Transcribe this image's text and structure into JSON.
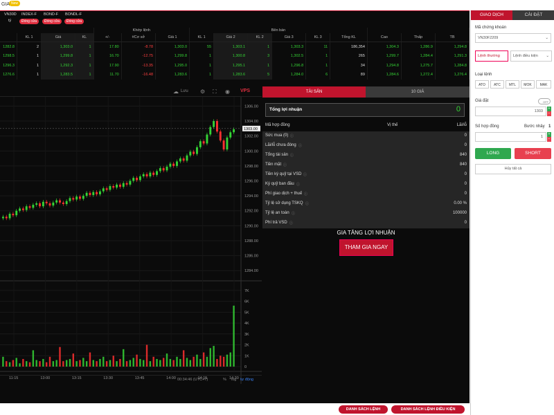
{
  "topbar": {
    "title": "GIA",
    "badge": "New"
  },
  "tickers": [
    {
      "name": "VN30D",
      "sub": "tỷ",
      "status": "Đóng cửa"
    },
    {
      "name": "INDEX-F",
      "sub": "",
      "status": "Đóng cửa"
    },
    {
      "name": "BOND-F",
      "sub": "",
      "status": "Đóng cửa"
    },
    {
      "name": "BONDL-F",
      "sub": "",
      "status": "Đóng cửa"
    }
  ],
  "board": {
    "group_headers": {
      "matched": "Khớp lệnh",
      "sell": "Bên bán"
    },
    "columns": [
      "KL 1",
      "Giá",
      "KL",
      "+/-",
      "#Cơ sở",
      "Giá 1",
      "KL 1",
      "Giá 2",
      "KL 2",
      "Giá 3",
      "KL 3",
      "Tổng KL",
      "Cao",
      "Thấp",
      "TB"
    ],
    "rows": [
      {
        "c0": "1282.8",
        "c1": "2",
        "c2": "1,303.0",
        "c3": "1",
        "c4": "17.80",
        "c5": "-8.78",
        "c6": "1,303.0",
        "c7": "55",
        "c8": "1,303.1",
        "c9": "1",
        "c10": "1,303.3",
        "c11": "11",
        "c12": "186,354",
        "c13": "1,304.3",
        "c14": "1,286.9",
        "c15": "1,294.8"
      },
      {
        "c0": "1298.5",
        "c1": "1",
        "c2": "1,299.8",
        "c3": "1",
        "c4": "16.70",
        "c5": "-12.75",
        "c6": "1,299.8",
        "c7": "1",
        "c8": "1,300.8",
        "c9": "3",
        "c10": "1,302.5",
        "c11": "1",
        "c12": "265",
        "c13": "1,299.7",
        "c14": "1,284.4",
        "c15": "1,291.3"
      },
      {
        "c0": "1296.3",
        "c1": "1",
        "c2": "1,292.3",
        "c3": "1",
        "c4": "17.90",
        "c5": "-13.35",
        "c6": "1,295.0",
        "c7": "1",
        "c8": "1,295.1",
        "c9": "1",
        "c10": "1,296.8",
        "c11": "1",
        "c12": "34",
        "c13": "1,294.8",
        "c14": "1,275.7",
        "c15": "1,284.8"
      },
      {
        "c0": "1276.6",
        "c1": "1",
        "c2": "1,283.5",
        "c3": "1",
        "c4": "11.70",
        "c5": "-16.48",
        "c6": "1,283.6",
        "c7": "1",
        "c8": "1,283.6",
        "c9": "5",
        "c10": "1,284.0",
        "c11": "6",
        "c12": "89",
        "c13": "1,284.6",
        "c14": "1,272.4",
        "c15": "1,276.4"
      }
    ]
  },
  "chart_toolbar": {
    "save": "Lưu",
    "logo": "VPS"
  },
  "chart_data": {
    "type": "candlestick",
    "x_ticks": [
      "11:15",
      "13:00",
      "13:15",
      "13:30",
      "13:45",
      "14:00",
      "14:15",
      "14:30"
    ],
    "price_ticks": [
      "1306.00",
      "1304.00",
      "1302.00",
      "1300.00",
      "1298.00",
      "1296.00",
      "1294.00",
      "1292.00",
      "1290.00",
      "1288.00",
      "1286.00",
      "1284.00"
    ],
    "volume_ticks": [
      "7K",
      "6K",
      "5K",
      "4K",
      "3K",
      "2K",
      "1K",
      "0"
    ],
    "price_range": [
      1283,
      1306.5
    ],
    "volume_range": [
      0,
      7500
    ],
    "current_price": "1303.00",
    "closes": [
      1291.2,
      1291.0,
      1291.6,
      1291.4,
      1292.0,
      1292.3,
      1292.1,
      1292.6,
      1292.4,
      1292.8,
      1293.0,
      1292.6,
      1293.2,
      1293.0,
      1292.7,
      1293.1,
      1293.4,
      1293.1,
      1292.9,
      1293.3,
      1293.7,
      1293.5,
      1293.9,
      1293.6,
      1294.0,
      1294.4,
      1294.1,
      1294.5,
      1294.2,
      1294.6,
      1295.0,
      1294.8,
      1295.3,
      1295.1,
      1295.5,
      1295.2,
      1295.7,
      1295.5,
      1296.0,
      1296.4,
      1296.1,
      1296.6,
      1296.9,
      1296.6,
      1297.1,
      1296.8,
      1297.3,
      1297.7,
      1297.4,
      1297.9,
      1298.3,
      1298.0,
      1298.6,
      1299.0,
      1298.7,
      1299.4,
      1299.9,
      1299.6,
      1300.5,
      1301.3,
      1301.0,
      1302.2,
      1303.2,
      1304.0,
      1302.6,
      1301.4,
      1300.2,
      1301.8,
      1302.5,
      1302.9
    ],
    "volumes": [
      900,
      500,
      400,
      600,
      800,
      300,
      700,
      500,
      400,
      1500,
      600,
      500,
      700,
      400,
      900,
      500,
      600,
      1800,
      500,
      600,
      700,
      1200,
      500,
      600,
      800,
      500,
      1300,
      600,
      500,
      700,
      900,
      500,
      600,
      1000,
      500,
      700,
      1600,
      500,
      600,
      800,
      1100,
      700,
      600,
      2000,
      500,
      900,
      700,
      600,
      800,
      1200,
      700,
      600,
      900,
      700,
      1500,
      800,
      600,
      900,
      1100,
      700,
      1300,
      900,
      1700,
      1900,
      700,
      1000,
      900,
      1100,
      1300,
      5600
    ],
    "time_label": "00:34:46 (UTC+7)",
    "footer_pct": "%",
    "footer_log": "log",
    "footer_auto": "tự động"
  },
  "trade_tabs": {
    "asset": "TÀI SẢN",
    "ten_price": "10 GIÁ"
  },
  "profit": {
    "label": "Tổng lợi nhuận",
    "value": "0"
  },
  "positions_header": {
    "contract": "Mã hợp đồng",
    "position": "Vị thế",
    "pl": "Lãi/lỗ"
  },
  "account_rows": [
    {
      "label": "Sức mua (0)",
      "value": "0"
    },
    {
      "label": "Lãi/lỗ chưa đóng",
      "value": "0"
    },
    {
      "label": "Tổng tài sản",
      "value": "840"
    },
    {
      "label": "Tiền mặt",
      "value": "840"
    },
    {
      "label": "Tiền ký quỹ tại VSD",
      "value": "0"
    },
    {
      "label": "Ký quỹ ban đầu",
      "value": "0"
    },
    {
      "label": "Phí giao dịch + thuế",
      "value": "0"
    },
    {
      "label": "Tỷ lệ sử dụng TSKQ",
      "value": "0.00 %"
    },
    {
      "label": "Tỷ lệ an toàn",
      "value": "100000"
    },
    {
      "label": "Phí trả VSD",
      "value": "0"
    }
  ],
  "promo": {
    "title": "GIA TĂNG LỢI NHUẬN",
    "button": "THAM GIA NGAY"
  },
  "order_panel": {
    "tab_trade": "GIAO DỊCH",
    "tab_settings": "CÀI ĐẶT",
    "symbol_label": "Mã chứng khoán",
    "symbol_value": "VN30F2209",
    "mode_normal": "Lệnh thường",
    "mode_conditional": "Lệnh điều kiện",
    "order_type_label": "Loại lệnh",
    "order_types": [
      "ATO",
      "ATC",
      "MTL",
      "MOK",
      "MAK"
    ],
    "price_label": "Giá đặt",
    "toggle_label": "OFF",
    "price_value": "1303",
    "qty_label": "Số hợp đồng",
    "step_label": "Bước nhảy",
    "step_value": "1",
    "qty_value": "1",
    "long_label": "LONG",
    "short_label": "SHORT",
    "cancel_all": "Hủy tất cả",
    "long_color": "#2fa84f",
    "short_color": "#e8404f"
  },
  "footer": {
    "order_list": "DANH SÁCH LỆNH",
    "cond_order_list": "DANH SÁCH LỆNH ĐIỀU KIỆN"
  }
}
